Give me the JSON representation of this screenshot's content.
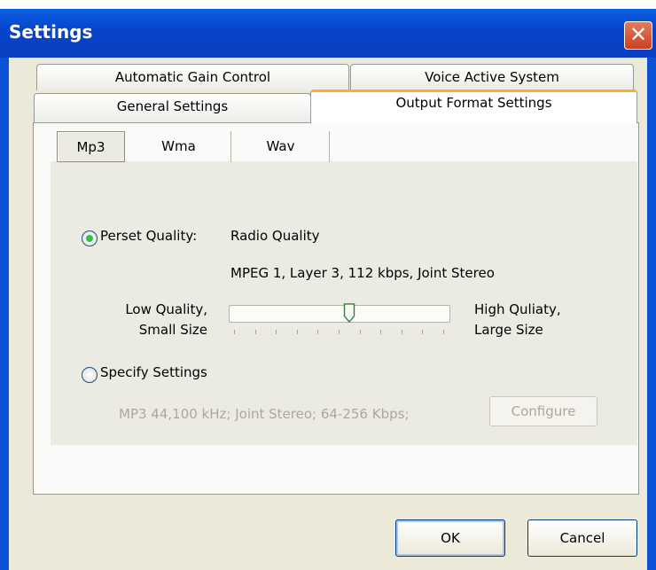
{
  "window": {
    "title": "Settings",
    "close_glyph": "✕"
  },
  "tabs": {
    "row1": [
      "Automatic Gain Control",
      "Voice Active System"
    ],
    "row2": [
      "General Settings",
      "Output Format Settings"
    ],
    "active": "Output Format Settings"
  },
  "format_tabs": {
    "items": [
      "Mp3",
      "Wma",
      "Wav"
    ],
    "active": "Mp3"
  },
  "preset": {
    "label": "Perset Quality:",
    "selected": true,
    "quality_name": "Radio Quality",
    "quality_detail": "MPEG 1, Layer 3, 112 kbps, Joint Stereo"
  },
  "slider": {
    "low_label_1": "Low Quality,",
    "low_label_2": "Small Size",
    "high_label_1": "High Quliaty,",
    "high_label_2": "Large Size",
    "position": 0.55,
    "tick_count": 11
  },
  "specify": {
    "label": "Specify Settings",
    "selected": false,
    "summary": "MP3 44,100 kHz; Joint Stereo;  64-256 Kbps;",
    "configure_label": "Configure"
  },
  "buttons": {
    "ok": "OK",
    "cancel": "Cancel"
  },
  "colors": {
    "titlebar": "#0843c9",
    "active_tab_accent": "#f8b12f",
    "radio_dot": "#35c146",
    "close": "#c8401f"
  }
}
